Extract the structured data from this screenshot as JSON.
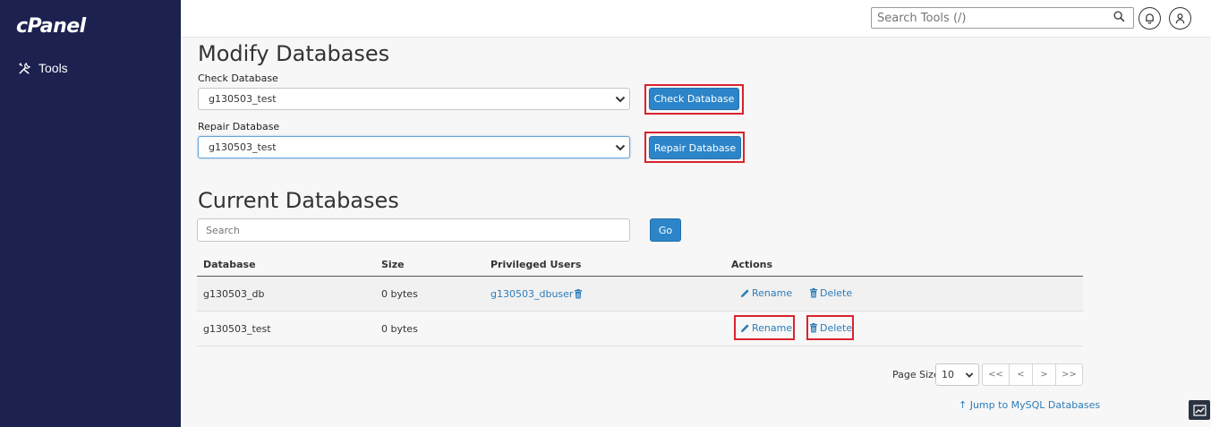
{
  "app": {
    "logo": "cPanel",
    "nav_tools": "Tools",
    "search_placeholder": "Search Tools (/)"
  },
  "modify": {
    "title": "Modify Databases",
    "check_label": "Check Database",
    "check_value": "g130503_test",
    "check_button": "Check Database",
    "repair_label": "Repair Database",
    "repair_value": "g130503_test",
    "repair_button": "Repair Database"
  },
  "current": {
    "title": "Current Databases",
    "search_placeholder": "Search",
    "go_button": "Go",
    "columns": [
      "Database",
      "Size",
      "Privileged Users",
      "Actions"
    ],
    "rows": [
      {
        "database": "g130503_db",
        "size": "0 bytes",
        "users": "g130503_dbuser",
        "rename": "Rename",
        "delete": "Delete"
      },
      {
        "database": "g130503_test",
        "size": "0 bytes",
        "users": "",
        "rename": "Rename",
        "delete": "Delete"
      }
    ]
  },
  "pagination": {
    "page_size_label": "Page Size",
    "page_size": "10",
    "first": "<<",
    "prev": "<",
    "next": ">",
    "last": ">>"
  },
  "jump_link": "Jump to MySQL Databases",
  "colors": {
    "sidebar": "#1c2150",
    "primary": "#2d85c9",
    "link": "#2d7cb8",
    "highlight": "#d9232e"
  }
}
